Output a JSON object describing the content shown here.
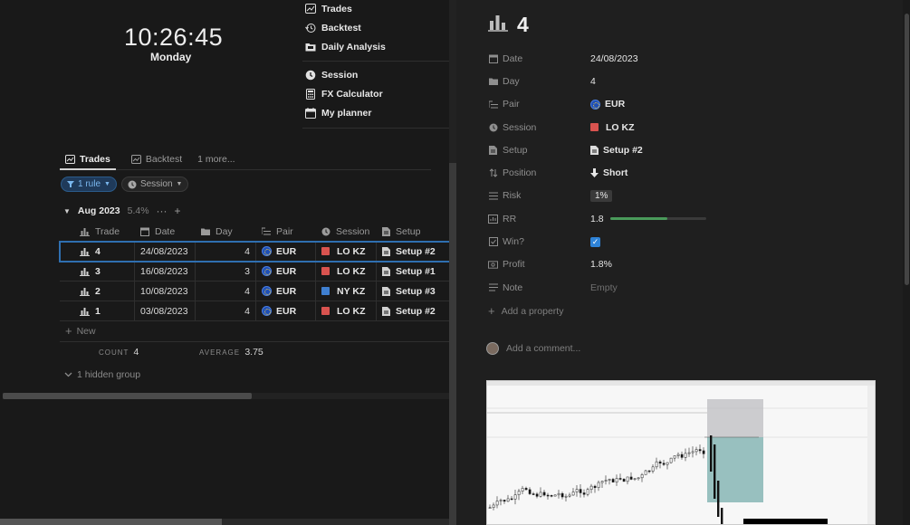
{
  "clock": {
    "time": "10:26:45",
    "day": "Monday"
  },
  "nav": {
    "group1": [
      {
        "label": "Trades",
        "icon": "trades-icon"
      },
      {
        "label": "Backtest",
        "icon": "history-icon"
      },
      {
        "label": "Daily Analysis",
        "icon": "folder-icon"
      }
    ],
    "group2": [
      {
        "label": "Session",
        "icon": "clock-icon"
      },
      {
        "label": "FX Calculator",
        "icon": "calculator-icon"
      },
      {
        "label": "My planner",
        "icon": "calendar-icon"
      }
    ]
  },
  "views": {
    "tab1": "Trades",
    "tab2": "Backtest",
    "more": "1 more..."
  },
  "filters": {
    "rule": "1 rule",
    "session": "Session"
  },
  "group": {
    "title": "Aug 2023",
    "pct": "5.4%",
    "more": "···",
    "add": "+"
  },
  "table": {
    "headers": {
      "trade": "Trade",
      "date": "Date",
      "day": "Day",
      "pair": "Pair",
      "session": "Session",
      "setup": "Setup"
    },
    "rows": [
      {
        "trade": "4",
        "date": "24/08/2023",
        "day": "4",
        "pair": "EUR",
        "session": "LO KZ",
        "session_color": "#d9534f",
        "setup": "Setup #2"
      },
      {
        "trade": "3",
        "date": "16/08/2023",
        "day": "3",
        "pair": "EUR",
        "session": "LO KZ",
        "session_color": "#d9534f",
        "setup": "Setup #1"
      },
      {
        "trade": "2",
        "date": "10/08/2023",
        "day": "4",
        "pair": "EUR",
        "session": "NY KZ",
        "session_color": "#3f7fd0",
        "setup": "Setup #3"
      },
      {
        "trade": "1",
        "date": "03/08/2023",
        "day": "4",
        "pair": "EUR",
        "session": "LO KZ",
        "session_color": "#d9534f",
        "setup": "Setup #2"
      }
    ],
    "new": "New",
    "count_label": "COUNT",
    "count": "4",
    "avg_label": "AVERAGE",
    "avg": "3.75",
    "hidden": "1 hidden group"
  },
  "detail": {
    "title": "4",
    "props": {
      "date": {
        "name": "Date",
        "value": "24/08/2023"
      },
      "day": {
        "name": "Day",
        "value": "4"
      },
      "pair": {
        "name": "Pair",
        "value": "EUR"
      },
      "session": {
        "name": "Session",
        "value": "LO KZ"
      },
      "setup": {
        "name": "Setup",
        "value": "Setup #2"
      },
      "position": {
        "name": "Position",
        "value": "Short"
      },
      "risk": {
        "name": "Risk",
        "value": "1%"
      },
      "rr": {
        "name": "RR",
        "value": "1.8",
        "fraction": 0.6
      },
      "win": {
        "name": "Win?",
        "checked": true
      },
      "profit": {
        "name": "Profit",
        "value": "1.8%"
      },
      "note": {
        "name": "Note",
        "value": "Empty"
      }
    },
    "add_property": "Add a property",
    "comment_placeholder": "Add a comment..."
  },
  "colors": {
    "accent": "#2e83d8",
    "session_lo": "#d9534f",
    "session_ny": "#3f7fd0"
  }
}
